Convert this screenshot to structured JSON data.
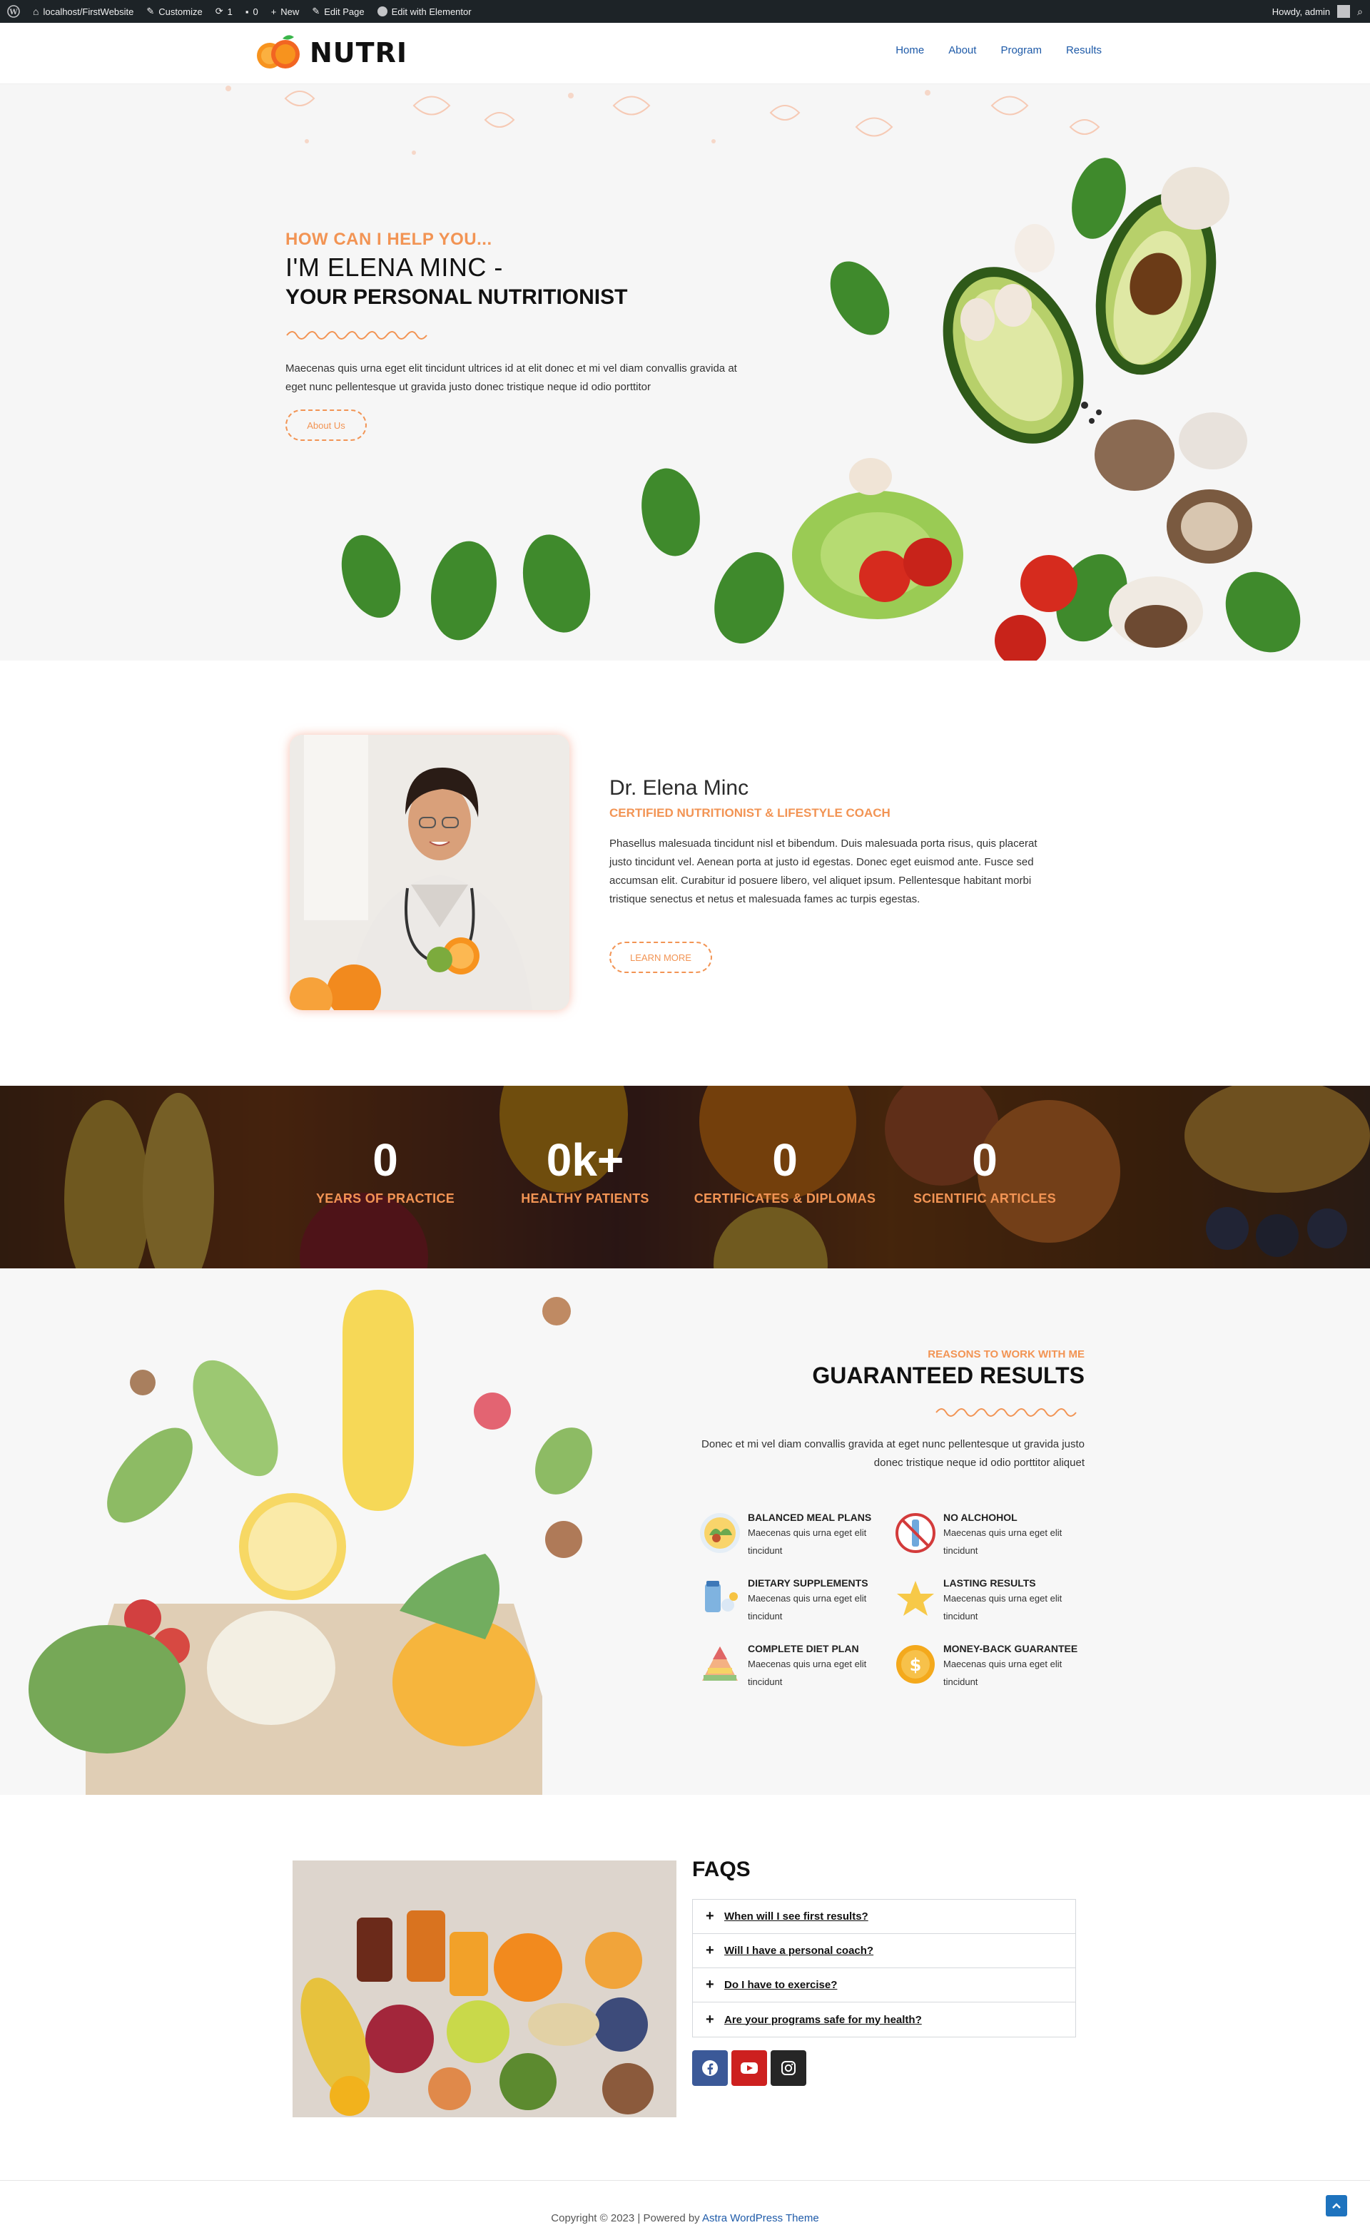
{
  "adminbar": {
    "site": "localhost/FirstWebsite",
    "customize": "Customize",
    "updates": "1",
    "comments": "0",
    "new": "New",
    "edit_page": "Edit Page",
    "elementor": "Edit with Elementor",
    "howdy": "Howdy, admin"
  },
  "brand": {
    "name": "NUTRI",
    "accent": "#f29454",
    "link": "#1e5aa8"
  },
  "nav": {
    "items": [
      "Home",
      "About",
      "Program",
      "Results"
    ]
  },
  "hero": {
    "kicker": "HOW CAN I HELP YOU...",
    "title_line1": "I'M ELENA MINC -",
    "title_line2": "YOUR PERSONAL NUTRITIONIST",
    "paragraph": "Maecenas quis urna eget elit tincidunt ultrices id at elit donec et mi vel diam convallis gravida at eget nunc pellentesque ut gravida justo donec tristique neque id odio porttitor",
    "button": "About Us"
  },
  "about": {
    "name": "Dr. Elena Minc",
    "role": "CERTIFIED NUTRITIONIST & LIFESTYLE COACH",
    "paragraph": "Phasellus malesuada tincidunt nisl et bibendum. Duis malesuada porta risus, quis placerat justo tincidunt vel. Aenean porta at justo id egestas. Donec eget euismod ante. Fusce sed accumsan elit. Curabitur id posuere libero, vel aliquet ipsum. Pellentesque habitant morbi tristique senectus et netus et malesuada fames ac turpis egestas.",
    "button": "LEARN MORE"
  },
  "counters": [
    {
      "value": "0",
      "label": "YEARS OF PRACTICE"
    },
    {
      "value": "0k+",
      "label": "HEALTHY PATIENTS"
    },
    {
      "value": "0",
      "label": "CERTIFICATES & DIPLOMAS"
    },
    {
      "value": "0",
      "label": "SCIENTIFIC ARTICLES"
    }
  ],
  "results": {
    "kicker": "REASONS TO WORK WITH ME",
    "title": "GUARANTEED RESULTS",
    "paragraph": "Donec et mi vel diam convallis gravida at eget nunc pellentesque ut gravida justo donec tristique neque id odio porttitor aliquet",
    "features": [
      {
        "title": "BALANCED MEAL PLANS",
        "desc": "Maecenas quis urna eget elit tincidunt",
        "icon": "meal-plate-icon"
      },
      {
        "title": "NO ALCHOHOL",
        "desc": "Maecenas quis urna eget elit tincidunt",
        "icon": "no-alcohol-icon"
      },
      {
        "title": "DIETARY SUPPLEMENTS",
        "desc": "Maecenas quis urna eget elit tincidunt",
        "icon": "supplements-icon"
      },
      {
        "title": "LASTING RESULTS",
        "desc": "Maecenas quis urna eget elit tincidunt",
        "icon": "star-icon"
      },
      {
        "title": "COMPLETE DIET PLAN",
        "desc": "Maecenas quis urna eget elit tincidunt",
        "icon": "food-pyramid-icon"
      },
      {
        "title": "MONEY-BACK GUARANTEE",
        "desc": "Maecenas quis urna eget elit tincidunt",
        "icon": "money-back-icon"
      }
    ]
  },
  "faq": {
    "title": "FAQS",
    "questions": [
      "When will I see first results?",
      "Will I have a personal coach?",
      "Do I have to exercise?",
      "Are your programs safe for my health?"
    ],
    "social": [
      {
        "icon": "facebook-icon",
        "color": "#3b5998"
      },
      {
        "icon": "youtube-icon",
        "color": "#cd201f"
      },
      {
        "icon": "instagram-icon",
        "color": "#262626"
      }
    ]
  },
  "footer": {
    "copyright": "Copyright © 2023 | Powered by",
    "theme_link": "Astra WordPress Theme"
  }
}
